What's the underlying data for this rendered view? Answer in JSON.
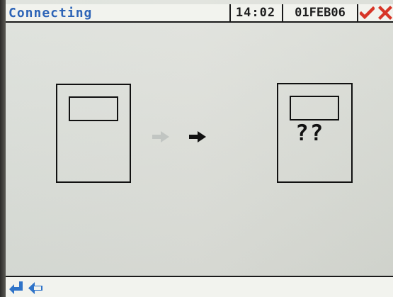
{
  "status_bar": {
    "title": "Connecting",
    "time": "14:02",
    "date": "01FEB06"
  },
  "devices": {
    "right_device_status": "??"
  },
  "icons": {
    "confirm": "checkmark-icon",
    "cancel": "close-icon",
    "enter": "enter-arrow-icon",
    "back": "back-arrow-icon",
    "device_left": "device-icon",
    "device_right": "unknown-device-icon",
    "connection_arrow_faded": "right-arrow-icon",
    "connection_arrow_active": "right-arrow-icon"
  },
  "colors": {
    "title": "#2d64b7",
    "accent_red": "#d73527",
    "nav_blue": "#2f73c8",
    "screen_background": "#d9ddd7"
  }
}
